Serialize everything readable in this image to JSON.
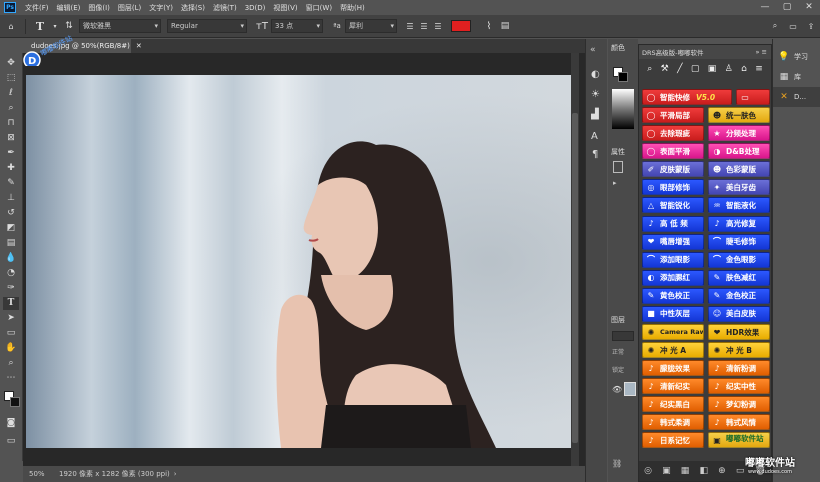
{
  "menubar": {
    "app_logo": "Ps",
    "items": [
      "文件(F)",
      "编辑(E)",
      "图像(I)",
      "图层(L)",
      "文字(Y)",
      "选择(S)",
      "滤镜(T)",
      "3D(D)",
      "视图(V)",
      "窗口(W)",
      "帮助(H)"
    ],
    "window_controls": [
      "—",
      "▢",
      "✕"
    ]
  },
  "options": {
    "font_family": "微软雅黑",
    "font_style": "Regular",
    "font_size": "33 点",
    "antialias": "犀利",
    "text_color": "#e02020"
  },
  "document": {
    "tab_title": "dudoes.jpg @ 50%(RGB/8#)",
    "close_label": "✕"
  },
  "statusbar": {
    "zoom": "50%",
    "dimensions": "1920 像素 x 1282 像素 (300 ppi)"
  },
  "color_panel": {
    "title_color": "颜色",
    "title_properties": "属性",
    "title_layers": "图层",
    "label_normal": "正常",
    "label_lock": "锁定"
  },
  "drs": {
    "title": "DRS高级版-嘟嘟软件",
    "collapse": "»",
    "menu": "≡",
    "rows": [
      [
        {
          "label": "智能快修",
          "extra": "V5.0",
          "color": "c-red",
          "icon": "◯"
        },
        {
          "label": "",
          "color": "c-red",
          "icon": "▭"
        }
      ],
      [
        {
          "label": "平滑局部",
          "color": "c-red",
          "icon": "◯"
        },
        {
          "label": "统一肤色",
          "color": "c-yel",
          "icon": "☻"
        }
      ],
      [
        {
          "label": "去除瑕疵",
          "color": "c-red",
          "icon": "◯"
        },
        {
          "label": "分频处理",
          "color": "c-pink",
          "icon": "★"
        }
      ],
      [
        {
          "label": "表面平滑",
          "color": "c-pink",
          "icon": "◯"
        },
        {
          "label": "D&B处理",
          "color": "c-pink",
          "icon": "◑"
        }
      ],
      [
        {
          "label": "皮肤蒙版",
          "color": "c-purp",
          "icon": "✐"
        },
        {
          "label": "色彩蒙版",
          "color": "c-purp",
          "icon": "☻"
        }
      ],
      [
        {
          "label": "眼部修饰",
          "color": "c-blue",
          "icon": "◎"
        },
        {
          "label": "美白牙齿",
          "color": "c-purp",
          "icon": "✦"
        }
      ],
      [
        {
          "label": "智能锐化",
          "color": "c-blue",
          "icon": "△"
        },
        {
          "label": "智能液化",
          "color": "c-blue",
          "icon": "♒"
        }
      ],
      [
        {
          "label": "高 低 频",
          "color": "c-blue",
          "icon": "♪"
        },
        {
          "label": "高光修复",
          "color": "c-blue",
          "icon": "♪"
        }
      ],
      [
        {
          "label": "嘴唇增强",
          "color": "c-blue",
          "icon": "❤"
        },
        {
          "label": "睫毛修饰",
          "color": "c-blue",
          "icon": "⌒"
        }
      ],
      [
        {
          "label": "添加眼影",
          "color": "c-blue",
          "icon": "⌒"
        },
        {
          "label": "金色眼影",
          "color": "c-blue",
          "icon": "⌒"
        }
      ],
      [
        {
          "label": "添加腮红",
          "color": "c-blue",
          "icon": "◐"
        },
        {
          "label": "肤色减红",
          "color": "c-blue",
          "icon": "✎"
        }
      ],
      [
        {
          "label": "黄色校正",
          "color": "c-blue",
          "icon": "✎"
        },
        {
          "label": "金色校正",
          "color": "c-blue",
          "icon": "✎"
        }
      ],
      [
        {
          "label": "中性灰层",
          "color": "c-blue",
          "icon": "■"
        },
        {
          "label": "美白皮肤",
          "color": "c-blue",
          "icon": "☺"
        }
      ],
      [
        {
          "label": "Camera Raw",
          "color": "c-gold",
          "icon": "✺"
        },
        {
          "label": "HDR效果",
          "color": "c-gold",
          "icon": "❤"
        }
      ],
      [
        {
          "label": "冲 光 A",
          "color": "c-gold",
          "icon": "✺"
        },
        {
          "label": "冲 光 B",
          "color": "c-gold",
          "icon": "✺"
        }
      ],
      [
        {
          "label": "朦胧效果",
          "color": "c-org",
          "icon": "♪"
        },
        {
          "label": "清新粉调",
          "color": "c-org",
          "icon": "♪"
        }
      ],
      [
        {
          "label": "清新纪实",
          "color": "c-org",
          "icon": "♪"
        },
        {
          "label": "纪实中性",
          "color": "c-org",
          "icon": "♪"
        }
      ],
      [
        {
          "label": "纪实黑白",
          "color": "c-org",
          "icon": "♪"
        },
        {
          "label": "梦幻粉调",
          "color": "c-org",
          "icon": "♪"
        }
      ],
      [
        {
          "label": "韩式柔调",
          "color": "c-org",
          "icon": "♪"
        },
        {
          "label": "韩式风情",
          "color": "c-org",
          "icon": "♪"
        }
      ],
      [
        {
          "label": "日系记忆",
          "color": "c-org",
          "icon": "♪"
        },
        {
          "label": "嘟嘟软件站",
          "extra": "www.dudoes.com",
          "color": "c-yel",
          "icon": "▣"
        }
      ]
    ],
    "toolbar_icons": [
      "⌕",
      "⚒",
      "╱",
      "▢",
      "▣",
      "♙",
      "⌂",
      "≡"
    ],
    "footer_icons": [
      "◎",
      "▣",
      "▦",
      "◧",
      "⊕",
      "▭",
      "🗑"
    ]
  },
  "right_strip": {
    "items": [
      {
        "icon": "💡",
        "label": "学习"
      },
      {
        "icon": "▦",
        "label": "库"
      },
      {
        "icon": "✕",
        "label": "D..."
      }
    ]
  },
  "watermark": {
    "title": "嘟嘟软件站",
    "url": "www.dudoes.com"
  },
  "badge": {
    "text": "嘟嘟软件站"
  }
}
